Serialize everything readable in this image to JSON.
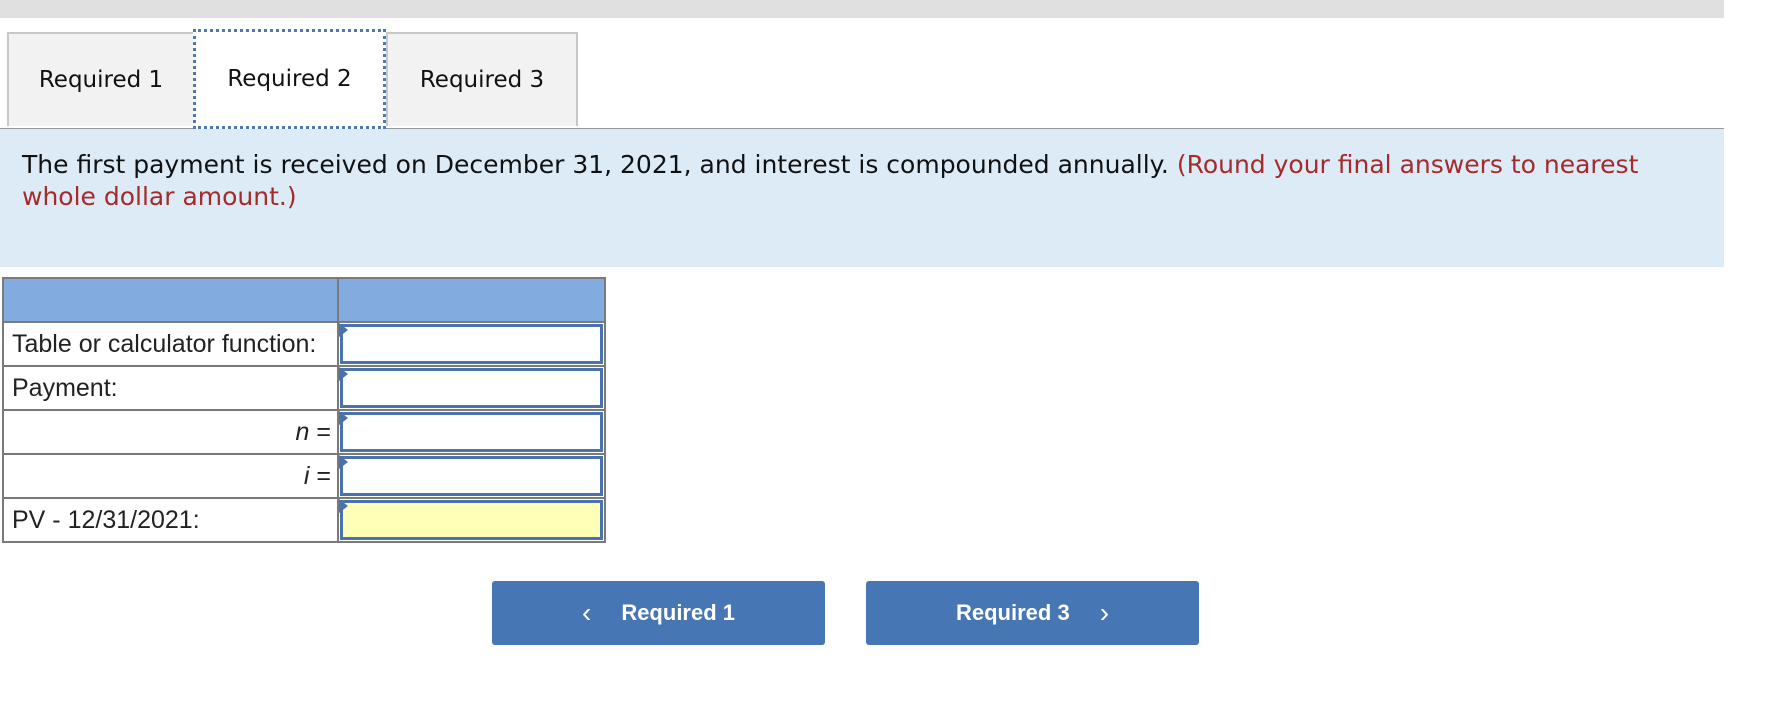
{
  "tabs": [
    {
      "label": "Required 1",
      "active": false
    },
    {
      "label": "Required 2",
      "active": true
    },
    {
      "label": "Required 3",
      "active": false
    }
  ],
  "prompt": {
    "text": "The first payment is received on December 31, 2021, and interest is compounded annually.",
    "instruction": "(Round your final answers to nearest whole dollar amount.)"
  },
  "table": {
    "header": [
      "",
      ""
    ],
    "rows": [
      {
        "label": "Table or calculator function:",
        "value": "",
        "align": "left"
      },
      {
        "label": "Payment:",
        "value": "",
        "align": "left"
      },
      {
        "label_var": "n",
        "label_suffix": " =",
        "value": "",
        "align": "right"
      },
      {
        "label_var": "i",
        "label_suffix": " =",
        "value": "",
        "align": "right"
      },
      {
        "label": "PV - 12/31/2021:",
        "value": "",
        "align": "left",
        "highlight": true
      }
    ]
  },
  "nav": {
    "prev_label": "Required 1",
    "next_label": "Required 3",
    "prev_icon": "chevron-left-icon",
    "next_icon": "chevron-right-icon"
  },
  "colors": {
    "header_blue": "#82acdf",
    "prompt_bg": "#ddebf7",
    "instruction_red": "#a52a2a",
    "button_blue": "#4676b3",
    "answer_yellow": "#ffffb8"
  }
}
